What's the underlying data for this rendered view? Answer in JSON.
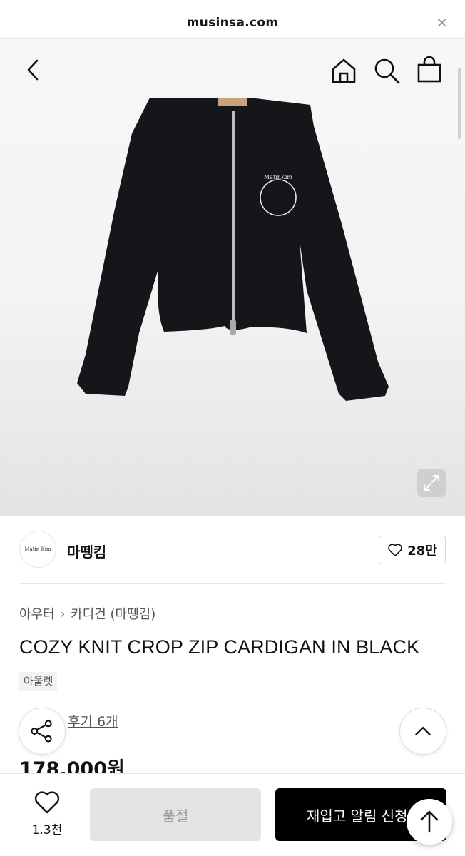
{
  "browser": {
    "url": "musinsa.com",
    "close_icon": "close-icon"
  },
  "header_nav": {
    "back_icon": "chevron-left-icon",
    "home_icon": "home-icon",
    "search_icon": "search-icon",
    "bag_icon": "shopping-bag-icon"
  },
  "hero": {
    "image": "black-zip-cardigan-photo",
    "logo_text": "MatinKim",
    "expand_icon": "expand-icon"
  },
  "brand": {
    "logo_text": "Matin Kim",
    "name": "마뗑킴",
    "like_count": "28만",
    "like_icon": "heart-outline-icon"
  },
  "product": {
    "breadcrumb": [
      "아우터",
      "카디건 (마뗑킴)"
    ],
    "title": "COZY KNIT CROP ZIP CARDIGAN IN BLACK",
    "tag": "아울렛",
    "review_label": "후기 6개",
    "price": "178,000원"
  },
  "bottom_bar": {
    "wish_count": "1.3천",
    "soldout_label": "품절",
    "restock_label": "재입고 알림 신청"
  },
  "colors": {
    "accent": "#000000",
    "star": "#f2b500",
    "soldout_bg": "#e4e4e4"
  }
}
